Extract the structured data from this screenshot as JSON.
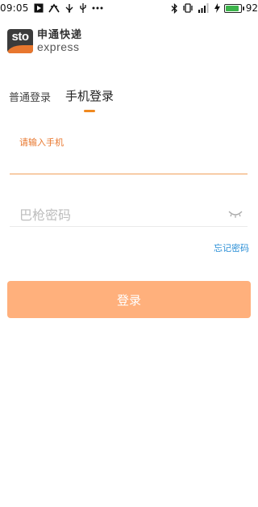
{
  "status_bar": {
    "time": "09:05",
    "battery_percent": "92",
    "battery_level": 0.92,
    "left_icons": [
      "play-box-icon",
      "cat-icon",
      "usb-icon",
      "usb-plug-icon",
      "more-dots-icon"
    ],
    "right_icons": [
      "bluetooth-icon",
      "vibrate-icon",
      "signal-icon",
      "charging-icon",
      "battery-icon"
    ]
  },
  "logo": {
    "mark_text": "sto",
    "name_cn": "申通快递",
    "name_en": "express",
    "accent_color": "#e8772e"
  },
  "tabs": [
    {
      "label": "普通登录",
      "active": false
    },
    {
      "label": "手机登录",
      "active": true
    }
  ],
  "phone_field": {
    "label": "请输入手机",
    "value": ""
  },
  "password_field": {
    "placeholder": "巴枪密码",
    "value": ""
  },
  "forgot_password": "忘记密码",
  "login_button": {
    "label": "登录",
    "color": "#ffb07c"
  },
  "colors": {
    "accent": "#f0891f",
    "link": "#2b8fd6"
  }
}
